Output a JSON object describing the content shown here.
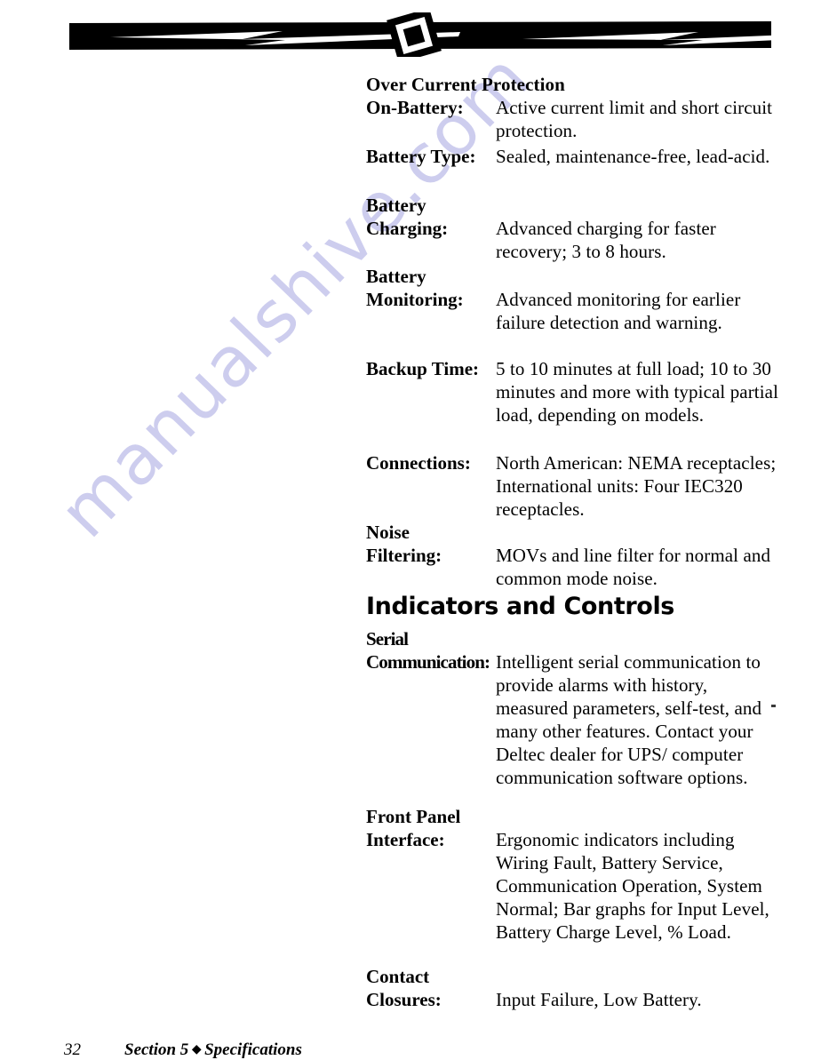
{
  "watermark": {
    "text": "manualshive.com",
    "color": "#cdcdee"
  },
  "header_ornament": {
    "name": "lightning-bolt-rule",
    "fill": "#000000"
  },
  "sections": [
    {
      "heading": "Over Current Protection",
      "entries": [
        {
          "label": "On-Battery:",
          "label_lines": [
            "On-Battery:"
          ],
          "value": "Active current limit and short circuit protection."
        },
        {
          "label": "Battery Type:",
          "label_lines": [
            "Battery Type:"
          ],
          "value": "Sealed, maintenance-free, lead-acid."
        },
        {
          "label": "Battery Charging:",
          "label_lines": [
            "Battery",
            "Charging:"
          ],
          "value": "Advanced charging for faster recovery; 3 to 8 hours."
        },
        {
          "label": "Battery Monitoring:",
          "label_lines": [
            "Battery",
            "Monitoring:"
          ],
          "value": "Advanced monitoring for earlier failure detection and warning."
        },
        {
          "label": "Backup Time:",
          "label_lines": [
            "Backup Time:"
          ],
          "value": "5 to 10 minutes at full load; 10 to 30 minutes and more with typical partial load, depending on models."
        },
        {
          "label": "Connections:",
          "label_lines": [
            "Connections:"
          ],
          "value": "North American:  NEMA receptacles; International units: Four IEC320 receptacles."
        },
        {
          "label": "Noise Filtering:",
          "label_lines": [
            "Noise",
            "Filtering:"
          ],
          "value": "MOVs and line filter for normal and common mode noise."
        }
      ]
    },
    {
      "heading": "Indicators and Controls",
      "entries": [
        {
          "label": "Serial Communication:",
          "label_lines": [
            "Serial",
            "Communication:"
          ],
          "value": "Intelligent serial communication to provide alarms with history, measured parameters, self-test, and many other features. Contact your Deltec dealer for UPS/ computer communication software options."
        },
        {
          "label": "Front Panel Interface:",
          "label_lines": [
            "Front Panel",
            "Interface:"
          ],
          "value": "Ergonomic indicators including Wiring Fault, Battery Service, Communication Operation, System Normal; Bar graphs for Input Level, Battery Charge Level, % Load."
        },
        {
          "label": "Contact Closures:",
          "label_lines": [
            "Contact",
            "Closures:"
          ],
          "value": "Input Failure, Low Battery."
        }
      ]
    }
  ],
  "footer": {
    "page_number": "32",
    "section_label_before": "Section 5",
    "diamond": "◆",
    "section_label_after": "Specifications"
  }
}
